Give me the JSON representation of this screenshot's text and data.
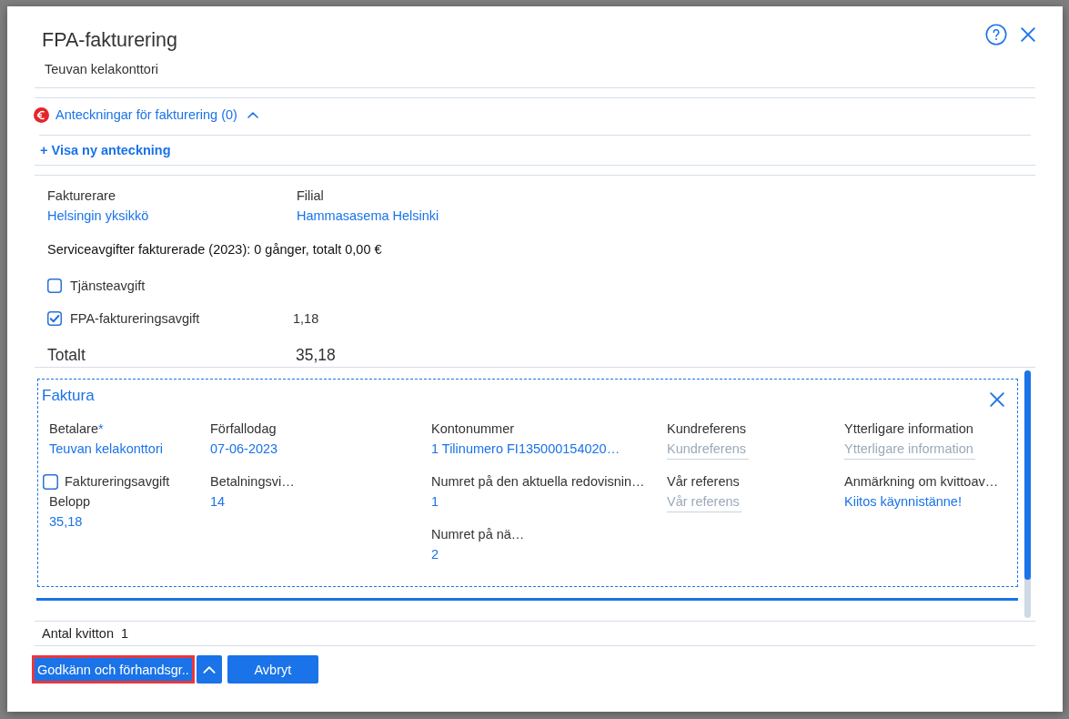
{
  "dialog": {
    "title": "FPA-fakturering",
    "subtitle": "Teuvan kelakonttori"
  },
  "notes": {
    "label": "Anteckningar för fakturering (0)",
    "expanded": true,
    "add_link": "+ Visa ny anteckning"
  },
  "biller": [
    {
      "label": "Fakturerare",
      "value": "Helsingin yksikkö"
    },
    {
      "label": "Filial",
      "value": "Hammasasema Helsinki"
    }
  ],
  "service_fees_summary": "Serviceavgifter fakturerade (2023): 0 gånger, totalt 0,00 €",
  "fees": [
    {
      "label": "Tjänsteavgift",
      "checked": false
    },
    {
      "label": "FPA-faktureringsavgift",
      "checked": true,
      "amount": "1,18"
    }
  ],
  "total": {
    "label": "Totalt",
    "value": "35,18"
  },
  "invoice": {
    "title": "Faktura",
    "columns": [
      [
        {
          "kind": "text",
          "label": "Betalare",
          "required_mark": "*",
          "value": "Teuvan kelakonttori"
        },
        {
          "kind": "checkbox",
          "label": "Faktureringsavgift",
          "checked": false
        },
        {
          "kind": "text",
          "label": "Belopp",
          "value": "35,18"
        }
      ],
      [
        {
          "kind": "text",
          "label": "Förfallodag",
          "value": "07-06-2023"
        },
        {
          "kind": "text",
          "label": "Betalningsvi…",
          "value": "14"
        }
      ],
      [
        {
          "kind": "text",
          "label": "Kontonummer",
          "value": "1 Tilinumero FI135000154020…"
        },
        {
          "kind": "text",
          "label": "Numret på den aktuella redovisnin…",
          "value": "1"
        },
        {
          "kind": "text",
          "label": "Numret på nä…",
          "value": "2"
        }
      ],
      [
        {
          "kind": "input",
          "label": "Kundreferens",
          "placeholder": "Kundreferens"
        },
        {
          "kind": "input",
          "label": "Vår referens",
          "placeholder": "Vår referens"
        }
      ],
      [
        {
          "kind": "input",
          "label": "Ytterligare information",
          "placeholder": "Ytterligare information"
        },
        {
          "kind": "text",
          "label": "Anmärkning om kvittoav…",
          "value": "Kiitos käynnistänne!"
        }
      ]
    ]
  },
  "receipts": {
    "label": "Antal kvitton",
    "value": "1"
  },
  "buttons": [
    {
      "kind": "text",
      "label": "Godkänn och förhandsgr..",
      "highlighted": true
    },
    {
      "kind": "menu"
    },
    {
      "kind": "text",
      "label": "Avbryt",
      "highlighted": false
    }
  ]
}
